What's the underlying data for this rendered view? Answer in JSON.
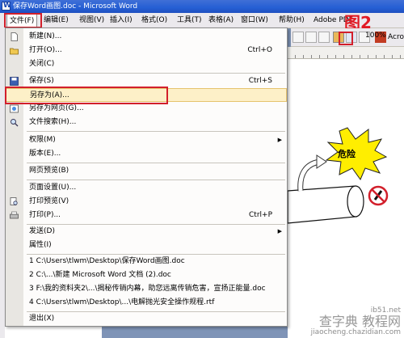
{
  "window": {
    "title": "保存Word画图.doc - Microsoft Word"
  },
  "menubar": {
    "items": [
      "文件(F)",
      "编辑(E)",
      "视图(V)",
      "插入(I)",
      "格式(O)",
      "工具(T)",
      "表格(A)",
      "窗口(W)",
      "帮助(H)",
      "Adobe PDF"
    ]
  },
  "annotation": {
    "label": "图2",
    "color": "#e11a24"
  },
  "toolbar": {
    "zoom": "100%",
    "acrobat": "Acrobat"
  },
  "file_menu": {
    "items": [
      {
        "label": "新建(N)...",
        "shortcut": "",
        "icon": "new-document-icon"
      },
      {
        "label": "打开(O)...",
        "shortcut": "Ctrl+O",
        "icon": "open-folder-icon"
      },
      {
        "label": "关闭(C)",
        "shortcut": "",
        "icon": ""
      },
      {
        "label": "保存(S)",
        "shortcut": "Ctrl+S",
        "icon": "save-disk-icon"
      },
      {
        "label": "另存为(A)...",
        "shortcut": "",
        "icon": ""
      },
      {
        "label": "另存为网页(G)...",
        "shortcut": "",
        "icon": "web-page-icon"
      },
      {
        "label": "文件搜索(H)...",
        "shortcut": "",
        "icon": "file-search-icon"
      },
      {
        "label": "权限(M)",
        "shortcut": "",
        "icon": ""
      },
      {
        "label": "版本(E)...",
        "shortcut": "",
        "icon": ""
      },
      {
        "label": "网页预览(B)",
        "shortcut": "",
        "icon": ""
      },
      {
        "label": "页面设置(U)...",
        "shortcut": "",
        "icon": ""
      },
      {
        "label": "打印预览(V)",
        "shortcut": "",
        "icon": "print-preview-icon"
      },
      {
        "label": "打印(P)...",
        "shortcut": "Ctrl+P",
        "icon": "printer-icon"
      },
      {
        "label": "发送(D)",
        "shortcut": "",
        "icon": ""
      },
      {
        "label": "属性(I)",
        "shortcut": "",
        "icon": ""
      },
      {
        "label": "1 C:\\Users\\tlwm\\Desktop\\保存Word画图.doc",
        "shortcut": "",
        "icon": ""
      },
      {
        "label": "2 C:\\...\\新建 Microsoft Word 文档 (2).doc",
        "shortcut": "",
        "icon": ""
      },
      {
        "label": "3 F:\\我的资料夹2\\...\\揭秘传销内幕，助您远离传销危害，宣扬正能量.doc",
        "shortcut": "",
        "icon": ""
      },
      {
        "label": "4 C:\\Users\\tlwm\\Desktop\\...\\电解抛光安全操作规程.rtf",
        "shortcut": "",
        "icon": ""
      },
      {
        "label": "退出(X)",
        "shortcut": "",
        "icon": ""
      }
    ]
  },
  "document": {
    "danger_label": "危险"
  },
  "watermark": {
    "line1": "ib51.net",
    "line2": "查字典 教程网",
    "line3": "jiaocheng.chazidian.com"
  },
  "colors": {
    "highlight_outline": "#d21f2b",
    "menu_highlight": "#fdf0c8"
  }
}
